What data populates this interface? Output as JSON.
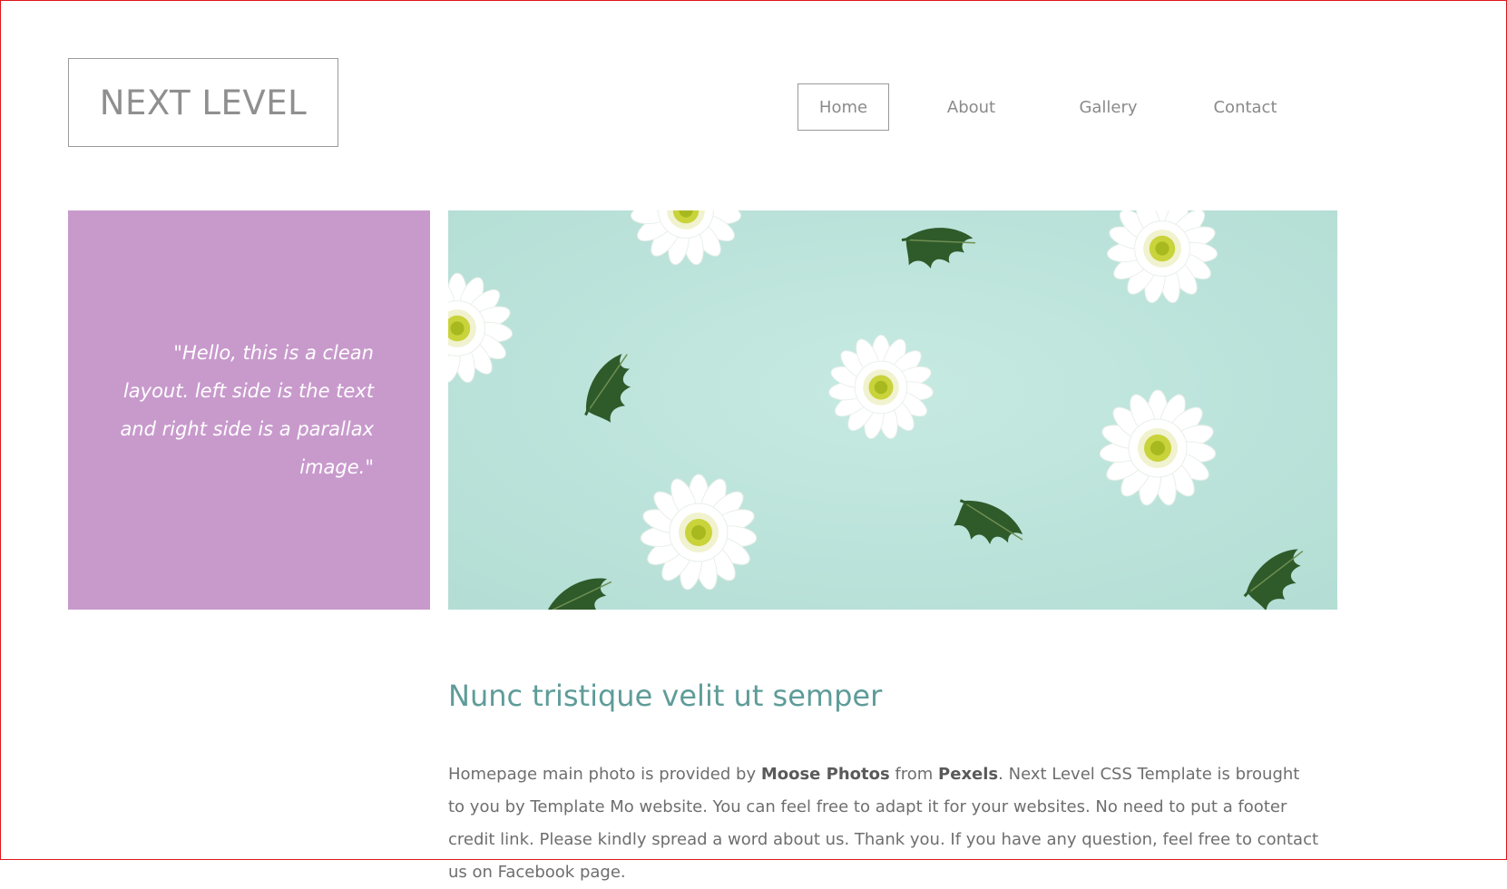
{
  "brand": {
    "logo_text": "NEXT LEVEL"
  },
  "nav": {
    "items": [
      {
        "label": "Home",
        "active": true
      },
      {
        "label": "About",
        "active": false
      },
      {
        "label": "Gallery",
        "active": false
      },
      {
        "label": "Contact",
        "active": false
      }
    ]
  },
  "quote": {
    "text": "\"Hello, this is a clean layout. left side is the text and right side is a parallax image.\""
  },
  "hero": {
    "image_description_icon": "flowers-photo",
    "background_color": "#bfe4dc"
  },
  "article": {
    "title": "Nunc tristique velit ut semper",
    "body_part1": "Homepage main photo is provided by ",
    "body_bold1": "Moose Photos",
    "body_part2": " from ",
    "body_bold2": "Pexels",
    "body_part3": ". Next Level CSS Template is brought to you by Template Mo website. You can feel free to adapt it for your websites. No need to put a footer credit link. Please kindly spread a word about us. Thank you. If you have any question, feel free to contact us on Facebook page."
  },
  "colors": {
    "accent_purple": "#c89acc",
    "title_teal": "#5e9c99",
    "frame_red": "#e0161a"
  }
}
